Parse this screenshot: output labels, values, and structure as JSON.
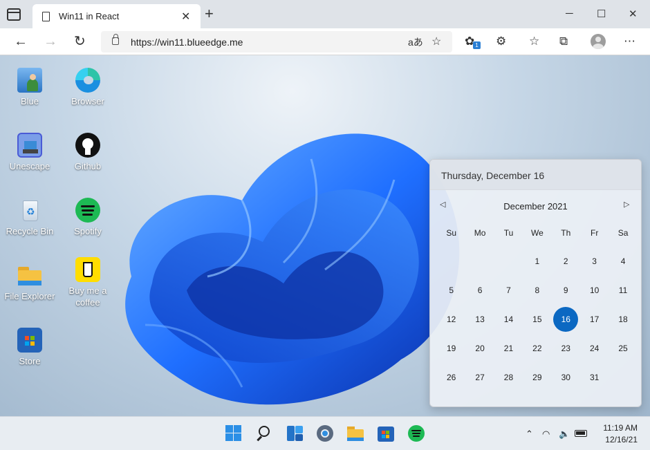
{
  "browser": {
    "tab_title": "Win11 in React",
    "url": "https://win11.blueedge.me",
    "extension_badge": "1",
    "translate_glyph": "aあ"
  },
  "desktop_icons": [
    {
      "label": "Blue"
    },
    {
      "label": "Browser"
    },
    {
      "label": "Unescape"
    },
    {
      "label": "Github"
    },
    {
      "label": "Recycle Bin"
    },
    {
      "label": "Spotify"
    },
    {
      "label": "File Explorer"
    },
    {
      "label": "Buy me a coffee"
    },
    {
      "label": "Store"
    }
  ],
  "calendar": {
    "header_date": "Thursday, December 16",
    "month_label": "December 2021",
    "weekdays": [
      "Su",
      "Mo",
      "Tu",
      "We",
      "Th",
      "Fr",
      "Sa"
    ],
    "weeks": [
      [
        "",
        "",
        "",
        "1",
        "2",
        "3",
        "4"
      ],
      [
        "5",
        "6",
        "7",
        "8",
        "9",
        "10",
        "11"
      ],
      [
        "12",
        "13",
        "14",
        "15",
        "16",
        "17",
        "18"
      ],
      [
        "19",
        "20",
        "21",
        "22",
        "23",
        "24",
        "25"
      ],
      [
        "26",
        "27",
        "28",
        "29",
        "30",
        "31",
        ""
      ]
    ],
    "today": "16"
  },
  "taskbar": {
    "apps": [
      "start-icon",
      "search-icon",
      "widgets-icon",
      "settings-icon",
      "file-explorer-icon",
      "store-icon",
      "spotify-icon"
    ],
    "time": "11:19 AM",
    "date": "12/16/21"
  },
  "colors": {
    "accent": "#0b68c2",
    "wallpaper_blue": "#1f6fff"
  }
}
